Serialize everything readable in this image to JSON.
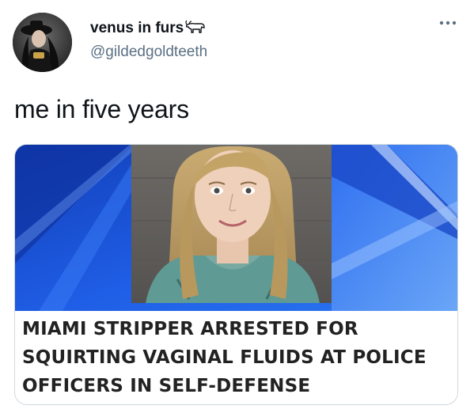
{
  "user": {
    "display_name": "venus in furs",
    "name_emoji": "ox-emoji",
    "handle": "@gildedgoldteeth",
    "avatar": "profile-photo"
  },
  "menu": {
    "icon": "more-options-icon"
  },
  "tweet": {
    "text": "me in five years"
  },
  "card": {
    "image": "news-broadcast-photo",
    "headline_lines": [
      "MIAMI STRIPPER ARRESTED FOR",
      "SQUIRTING VAGINAL FLUIDS AT POLICE",
      "OFFICERS IN SELF-DEFENSE"
    ]
  },
  "colors": {
    "text": "#0f1419",
    "secondary": "#5b7083",
    "border": "#cfd9de",
    "news_blue": "#1a4fd6"
  }
}
